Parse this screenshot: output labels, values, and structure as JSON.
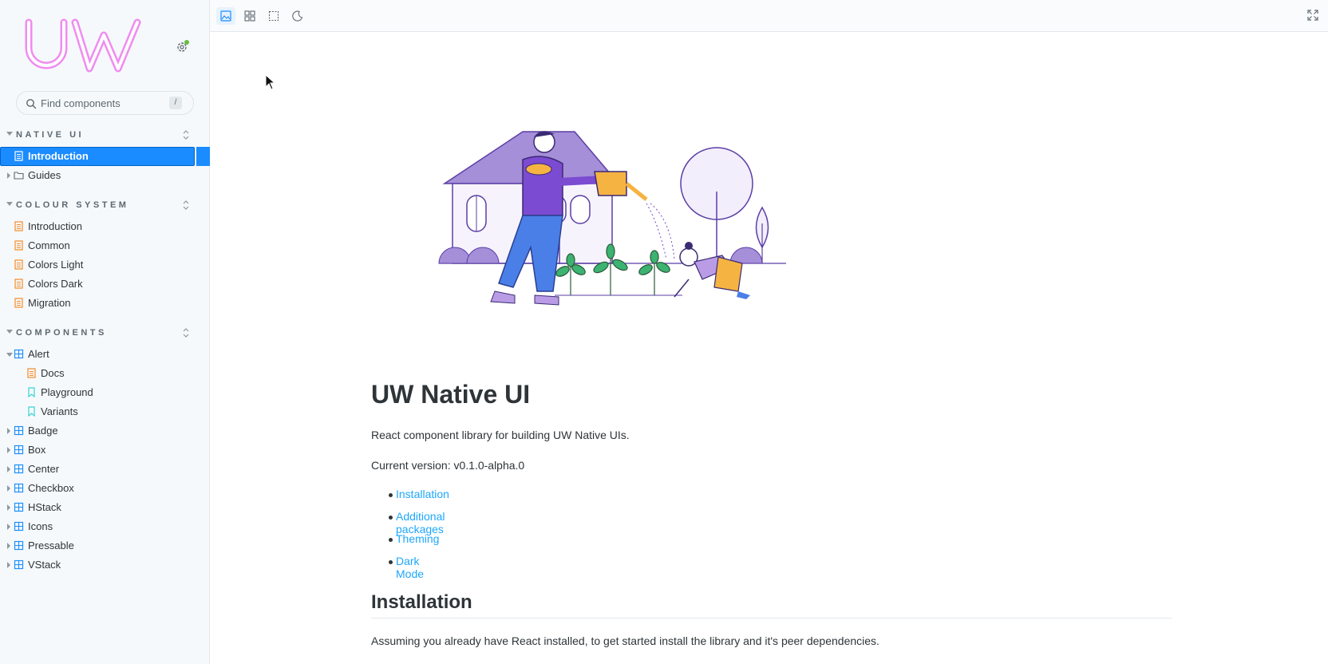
{
  "sidebar": {
    "search": {
      "placeholder": "Find components",
      "shortcut": "/"
    },
    "sections": [
      {
        "label": "NATIVE UI"
      },
      {
        "label": "COLOUR SYSTEM"
      },
      {
        "label": "COMPONENTS"
      }
    ],
    "native_ui": [
      {
        "label": "Introduction",
        "selected": true
      },
      {
        "label": "Guides"
      }
    ],
    "colour_system": [
      {
        "label": "Introduction"
      },
      {
        "label": "Common"
      },
      {
        "label": "Colors Light"
      },
      {
        "label": "Colors Dark"
      },
      {
        "label": "Migration"
      }
    ],
    "components": {
      "alert": {
        "label": "Alert",
        "children": [
          "Docs",
          "Playground",
          "Variants"
        ]
      },
      "others": [
        "Badge",
        "Box",
        "Center",
        "Checkbox",
        "HStack",
        "Icons",
        "Pressable",
        "VStack"
      ]
    }
  },
  "toolbar": {
    "icons": [
      "image-icon",
      "grid-icon",
      "outline-icon",
      "moon-icon"
    ],
    "fullscreen": "fullscreen-icon"
  },
  "content": {
    "title": "UW Native UI",
    "description": "React component library for building UW Native UIs.",
    "version": "Current version: v0.1.0-alpha.0",
    "links": [
      "Installation",
      "Additional packages",
      "Theming",
      "Dark Mode"
    ],
    "section_title": "Installation",
    "section_text": "Assuming you already have React installed, to get started install the library and it's peer dependencies."
  },
  "colors": {
    "accent": "#1a8cff",
    "link": "#1ea7fd",
    "logo": "#f08cf0",
    "doc_icon": "#f28c28",
    "component_icon": "#1e90ff",
    "story_icon": "#37d5d3"
  }
}
